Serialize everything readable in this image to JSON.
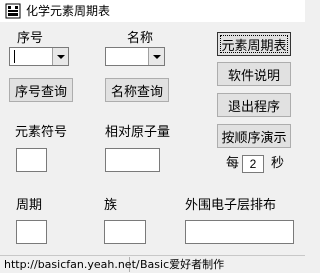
{
  "window": {
    "title": "化学元素周期表"
  },
  "labels": {
    "serial": "序号",
    "name": "名称",
    "symbol": "元素符号",
    "mass": "相对原子量",
    "period": "周期",
    "group": "族",
    "electrons": "外围电子层排布",
    "per_prefix": "每",
    "per_suffix": "秒"
  },
  "buttons": {
    "query_serial": "序号查询",
    "query_name": "名称查询",
    "periodic_table": "元素周期表",
    "help": "软件说明",
    "exit": "退出程序",
    "demo": "按顺序演示"
  },
  "inputs": {
    "serial_value": "",
    "name_value": "",
    "symbol_value": "",
    "mass_value": "",
    "period_value": "",
    "group_value": "",
    "electrons_value": "",
    "interval_value": "2"
  },
  "statusbar": {
    "url": "http://basicfan.yeah.net/",
    "credit": "Basic爱好者制作"
  },
  "icons": {
    "app": "app-icon",
    "combo_arrow": "chevron-down-icon"
  }
}
